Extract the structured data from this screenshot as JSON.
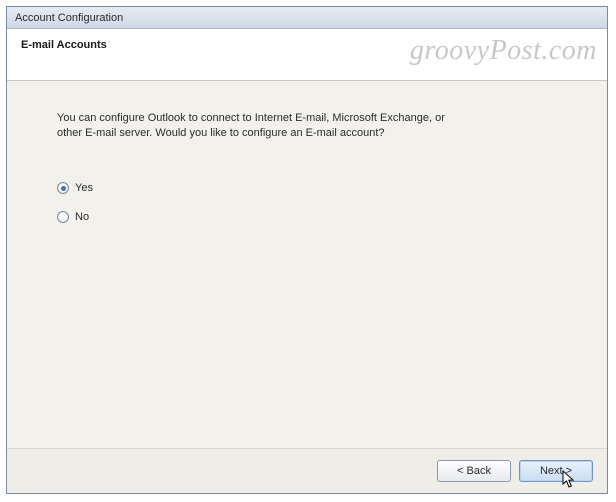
{
  "titlebar": {
    "title": "Account Configuration"
  },
  "header": {
    "heading": "E-mail Accounts"
  },
  "watermark": "groovyPost.com",
  "content": {
    "prompt_line1": "You can configure Outlook to connect to Internet E-mail, Microsoft Exchange, or",
    "prompt_line2": "other E-mail server. Would you like to configure an E-mail account?",
    "radio": {
      "yes": "Yes",
      "no": "No",
      "selected": "yes"
    }
  },
  "footer": {
    "back": "< Back",
    "next": "Next >"
  }
}
